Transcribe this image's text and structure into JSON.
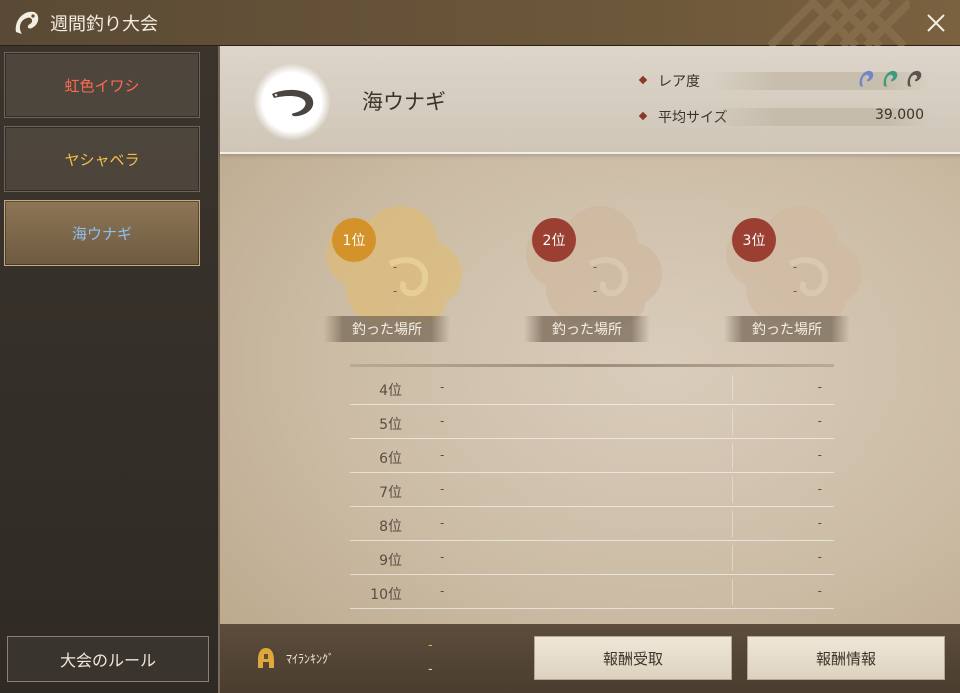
{
  "window": {
    "title": "週間釣り大会",
    "close_icon": "close-icon"
  },
  "sidebar": {
    "items": [
      {
        "label": "虹色イワシ",
        "color": "#ff6a52",
        "active": false
      },
      {
        "label": "ヤシャベラ",
        "color": "#f2c04a",
        "active": false
      },
      {
        "label": "海ウナギ",
        "color": "#8cc0f2",
        "active": true
      }
    ],
    "rules_button": "大会のルール"
  },
  "fish": {
    "name": "海ウナギ",
    "rarity_label": "レア度",
    "rarity_icons": [
      "#6f86c8",
      "#3e9a7e",
      "#5a5550"
    ],
    "avg_size_label": "平均サイズ",
    "avg_size_value": "39.000"
  },
  "podium": [
    {
      "rank": "1位",
      "name": "-",
      "value": "-",
      "location": "釣った場所",
      "badge_color": "#d4932a"
    },
    {
      "rank": "2位",
      "name": "-",
      "value": "-",
      "location": "釣った場所",
      "badge_color": "#9a3f32"
    },
    {
      "rank": "3位",
      "name": "-",
      "value": "-",
      "location": "釣った場所",
      "badge_color": "#9a3f32"
    }
  ],
  "ranking": [
    {
      "rank": "4位",
      "name": "-",
      "value": "-"
    },
    {
      "rank": "5位",
      "name": "-",
      "value": "-"
    },
    {
      "rank": "6位",
      "name": "-",
      "value": "-"
    },
    {
      "rank": "7位",
      "name": "-",
      "value": "-"
    },
    {
      "rank": "8位",
      "name": "-",
      "value": "-"
    },
    {
      "rank": "9位",
      "name": "-",
      "value": "-"
    },
    {
      "rank": "10位",
      "name": "-",
      "value": "-"
    }
  ],
  "footer": {
    "my_ranking_label": "ﾏｲﾗﾝｷﾝｸﾞ",
    "my_ranking_value": "-",
    "my_ranking_value2": "-",
    "claim_reward_button": "報酬受取",
    "reward_info_button": "報酬情報"
  }
}
